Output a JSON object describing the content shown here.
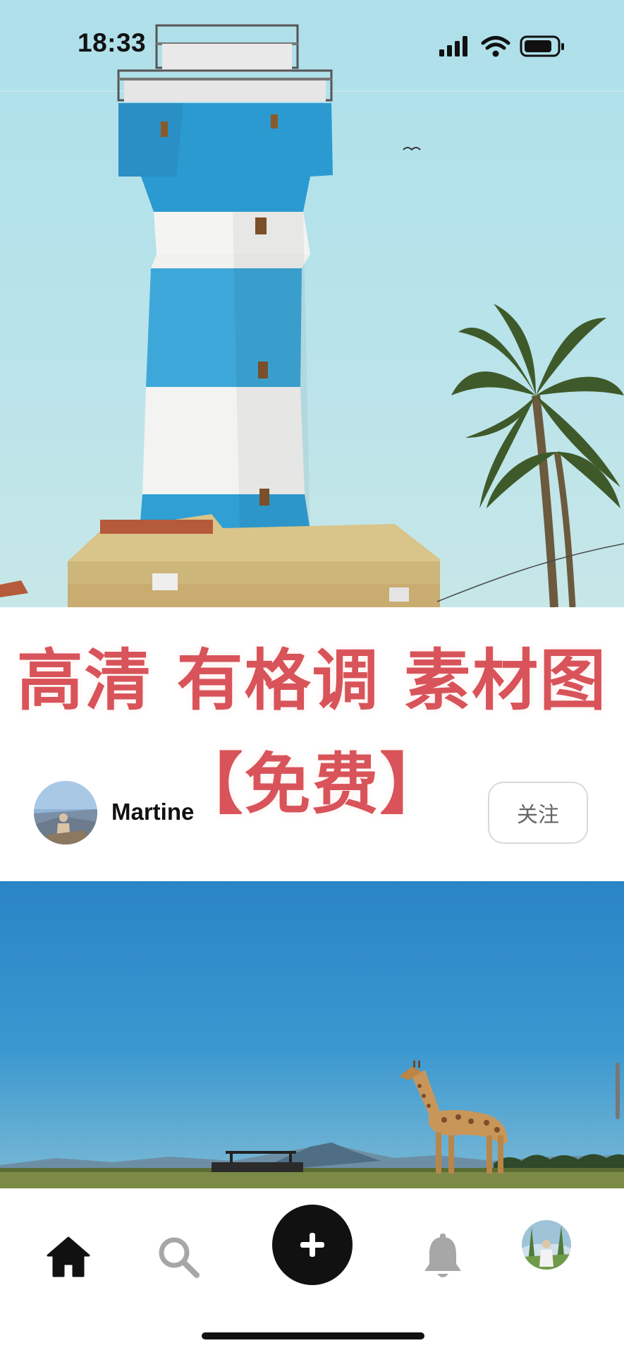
{
  "status_bar": {
    "time": "18:33",
    "icons": [
      "signal-icon",
      "wifi-icon",
      "battery-icon"
    ]
  },
  "post": {
    "overlay_text_line1": "高清 有格调 素材图",
    "overlay_text_line2": "【免费】",
    "author_name": "Martine",
    "follow_label": "关注"
  },
  "bottom_nav": {
    "items": [
      "home-icon",
      "search-icon",
      "plus-icon",
      "bell-icon",
      "profile-avatar"
    ],
    "active": "home-icon"
  },
  "colors": {
    "overlay_text": "#d8545a",
    "nav_active": "#111111",
    "nav_inactive": "#a7a7a7",
    "create_button": "#111111"
  }
}
